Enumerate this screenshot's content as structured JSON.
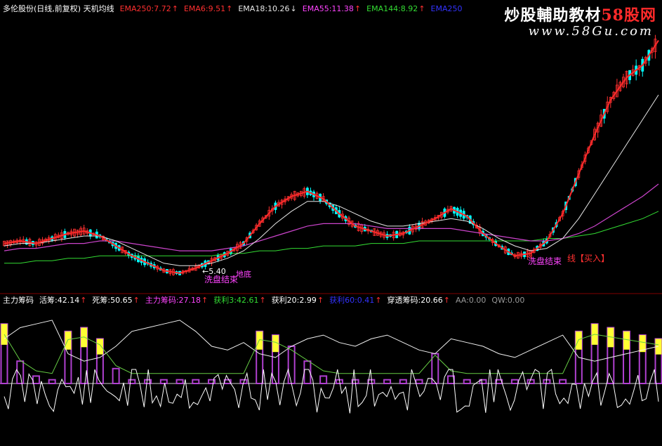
{
  "top_header": {
    "title": "多伦股份(日线,前复权) 天机均线",
    "items": [
      {
        "label": "EMA250:7.72",
        "color": "#ff3030",
        "arrow": "up"
      },
      {
        "label": "EMA6:9.51",
        "color": "#ff3030",
        "arrow": "up"
      },
      {
        "label": "EMA18:10.26",
        "color": "#e8e8e8",
        "arrow": "down"
      },
      {
        "label": "EMA55:11.38",
        "color": "#ff44ff",
        "arrow": "up"
      },
      {
        "label": "EMA144:8.92",
        "color": "#33dd33",
        "arrow": "up"
      },
      {
        "label": "EMA250",
        "color": "#3333ff",
        "arrow": "none"
      }
    ]
  },
  "bottom_header": {
    "items": [
      {
        "label": "主力筹码",
        "color": "#ffffff",
        "arrow": "none"
      },
      {
        "label": "活筹:42.14",
        "color": "#ffffff",
        "arrow": "up"
      },
      {
        "label": "死筹:50.65",
        "color": "#ffffff",
        "arrow": "up"
      },
      {
        "label": "主力筹码:27.18",
        "color": "#ff44ff",
        "arrow": "up"
      },
      {
        "label": "获利3:42.61",
        "color": "#33dd33",
        "arrow": "up"
      },
      {
        "label": "获利20:2.99",
        "color": "#ffffff",
        "arrow": "up"
      },
      {
        "label": "获利60:0.41",
        "color": "#3333ff",
        "arrow": "up"
      },
      {
        "label": "穿透筹码:20.66",
        "color": "#ffffff",
        "arrow": "up"
      },
      {
        "label": "AA:0.00",
        "color": "#999999",
        "arrow": "none"
      },
      {
        "label": "QW:0.00",
        "color": "#999999",
        "arrow": "none"
      }
    ]
  },
  "annotations": {
    "low_price": "←5.40",
    "bottom_label": "地底",
    "wash_end_1": "洗盘结束",
    "wash_end_2": "洗盘结束",
    "buy_line": "线【买入】"
  },
  "watermark": {
    "title_white": "炒股輔助教材",
    "title_red": "58股网",
    "url": "www.58Gu.com"
  },
  "colors": {
    "background": "#000000",
    "candle_up": "#ff3030",
    "candle_down": "#00ffff",
    "ema6": "#ff2a2a",
    "ema18": "#e8e8e8",
    "ema55": "#cc44cc",
    "ema144": "#33dd33",
    "bar_main": "#b040d0",
    "bar_top": "#ffff33"
  },
  "chart_data": [
    {
      "type": "line",
      "title": "天机均线",
      "note": "candlestick with moving averages",
      "series": [
        {
          "name": "EMA6",
          "values": [
            6.8,
            6.9,
            6.8,
            7.0,
            7.2,
            7.3,
            7.1,
            6.7,
            6.3,
            6.0,
            5.7,
            5.6,
            5.8,
            6.1,
            6.4,
            6.8,
            7.6,
            8.3,
            8.7,
            8.9,
            8.6,
            8.0,
            7.5,
            7.3,
            7.1,
            7.2,
            7.5,
            7.8,
            8.2,
            7.9,
            7.2,
            6.7,
            6.3,
            6.4,
            6.9,
            8.0,
            9.6,
            11.2,
            12.6,
            13.5,
            14.0,
            15.0
          ]
        },
        {
          "name": "EMA18",
          "values": [
            6.7,
            6.8,
            6.8,
            6.9,
            7.0,
            7.1,
            7.1,
            6.9,
            6.6,
            6.3,
            6.0,
            5.9,
            5.9,
            6.0,
            6.2,
            6.5,
            7.0,
            7.6,
            8.1,
            8.5,
            8.5,
            8.3,
            8.0,
            7.7,
            7.5,
            7.5,
            7.6,
            7.7,
            7.8,
            7.7,
            7.4,
            7.0,
            6.7,
            6.5,
            6.6,
            7.0,
            7.8,
            8.8,
            9.8,
            10.8,
            11.8,
            12.8
          ]
        },
        {
          "name": "EMA55",
          "values": [
            6.5,
            6.6,
            6.6,
            6.7,
            6.8,
            6.8,
            6.9,
            6.9,
            6.8,
            6.7,
            6.6,
            6.5,
            6.5,
            6.5,
            6.6,
            6.7,
            6.9,
            7.1,
            7.3,
            7.5,
            7.6,
            7.6,
            7.6,
            7.5,
            7.4,
            7.4,
            7.4,
            7.4,
            7.4,
            7.3,
            7.2,
            7.1,
            7.0,
            6.9,
            6.9,
            7.0,
            7.2,
            7.5,
            7.9,
            8.3,
            8.7,
            9.2
          ]
        },
        {
          "name": "EMA144",
          "values": [
            6.0,
            6.0,
            6.1,
            6.1,
            6.2,
            6.2,
            6.3,
            6.3,
            6.3,
            6.3,
            6.3,
            6.3,
            6.3,
            6.3,
            6.4,
            6.4,
            6.5,
            6.5,
            6.6,
            6.6,
            6.7,
            6.7,
            6.7,
            6.8,
            6.8,
            6.8,
            6.9,
            6.9,
            6.9,
            6.9,
            6.9,
            6.9,
            6.9,
            6.9,
            7.0,
            7.0,
            7.1,
            7.2,
            7.4,
            7.6,
            7.8,
            8.1
          ]
        }
      ]
    },
    {
      "type": "bar",
      "title": "主力筹码",
      "series": [
        {
          "name": "主力筹码",
          "values": [
            80,
            30,
            10,
            5,
            70,
            75,
            60,
            20,
            5,
            5,
            5,
            5,
            5,
            5,
            5,
            5,
            70,
            65,
            50,
            30,
            10,
            5,
            5,
            5,
            5,
            5,
            5,
            40,
            10,
            5,
            5,
            5,
            5,
            5,
            5,
            5,
            70,
            80,
            75,
            70,
            65,
            60
          ]
        },
        {
          "name": "活筹",
          "values": [
            60,
            75,
            80,
            85,
            40,
            30,
            35,
            50,
            70,
            75,
            80,
            85,
            70,
            50,
            45,
            55,
            40,
            35,
            50,
            60,
            65,
            55,
            50,
            60,
            65,
            55,
            45,
            40,
            60,
            55,
            50,
            40,
            35,
            45,
            55,
            65,
            35,
            30,
            35,
            40,
            45,
            50
          ]
        }
      ]
    }
  ]
}
